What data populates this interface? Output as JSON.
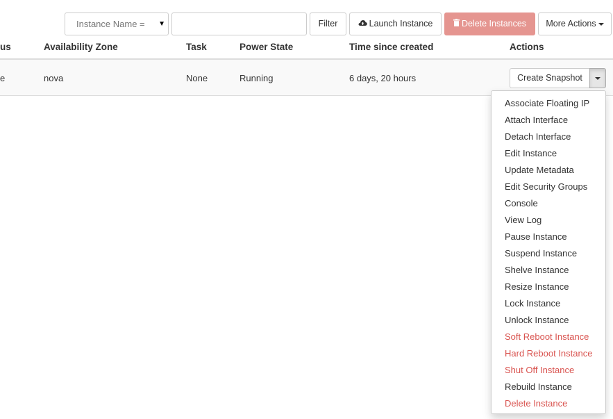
{
  "toolbar": {
    "filter_field": "Instance Name =",
    "filter_value": "",
    "filter_label": "Filter",
    "launch_label": "Launch Instance",
    "delete_label": "Delete Instances",
    "more_label": "More Actions"
  },
  "table": {
    "columns": [
      "us",
      "Availability Zone",
      "Task",
      "Power State",
      "Time since created",
      "Actions"
    ],
    "rows": [
      {
        "status": "e",
        "availability_zone": "nova",
        "task": "None",
        "power_state": "Running",
        "time_since_created": "6 days, 20 hours",
        "action_label": "Create Snapshot"
      }
    ]
  },
  "actions_menu": [
    {
      "label": "Associate Floating IP",
      "danger": false
    },
    {
      "label": "Attach Interface",
      "danger": false
    },
    {
      "label": "Detach Interface",
      "danger": false
    },
    {
      "label": "Edit Instance",
      "danger": false
    },
    {
      "label": "Update Metadata",
      "danger": false
    },
    {
      "label": "Edit Security Groups",
      "danger": false
    },
    {
      "label": "Console",
      "danger": false
    },
    {
      "label": "View Log",
      "danger": false
    },
    {
      "label": "Pause Instance",
      "danger": false
    },
    {
      "label": "Suspend Instance",
      "danger": false
    },
    {
      "label": "Shelve Instance",
      "danger": false
    },
    {
      "label": "Resize Instance",
      "danger": false
    },
    {
      "label": "Lock Instance",
      "danger": false
    },
    {
      "label": "Unlock Instance",
      "danger": false
    },
    {
      "label": "Soft Reboot Instance",
      "danger": true
    },
    {
      "label": "Hard Reboot Instance",
      "danger": true
    },
    {
      "label": "Shut Off Instance",
      "danger": true
    },
    {
      "label": "Rebuild Instance",
      "danger": false
    },
    {
      "label": "Delete Instance",
      "danger": true
    }
  ],
  "icons": {
    "filter_field_caret": "caret-down-icon",
    "launch": "cloud-upload-icon",
    "delete": "trash-icon",
    "more": "caret-down-icon",
    "row_actions": "caret-down-icon"
  },
  "colors": {
    "danger": "#d9534f",
    "delete_button": "#e59590",
    "row_background": "#f9f9f9"
  }
}
